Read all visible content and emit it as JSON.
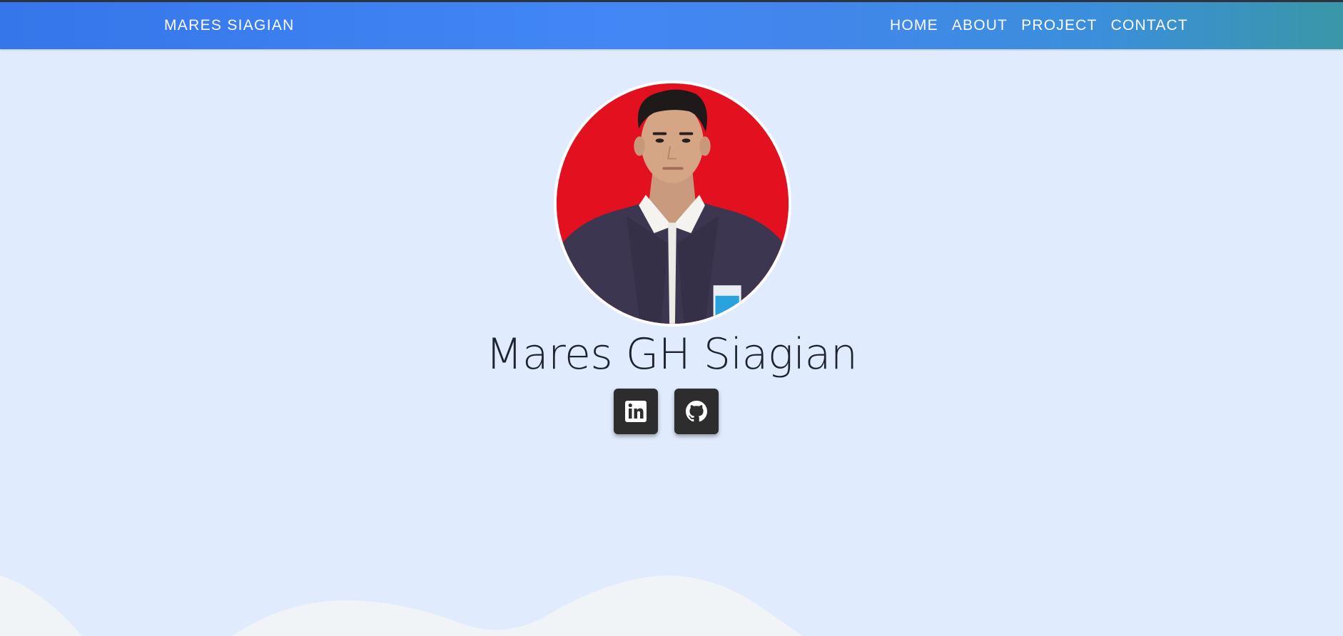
{
  "navbar": {
    "brand": "MARES SIAGIAN",
    "links": [
      {
        "label": "HOME"
      },
      {
        "label": "ABOUT"
      },
      {
        "label": "PROJECT"
      },
      {
        "label": "CONTACT"
      }
    ]
  },
  "hero": {
    "name": "Mares GH Siagian",
    "photo_alt": "Mares GH Siagian profile photo",
    "social": [
      {
        "icon": "linkedin-icon",
        "aria": "LinkedIn"
      },
      {
        "icon": "github-icon",
        "aria": "GitHub"
      }
    ]
  },
  "colors": {
    "page_background": "#e0ecfd",
    "nav_gradient_start": "#3576ea",
    "nav_gradient_end": "#3a97a7",
    "button_background": "#2d2d2d",
    "wave": "#f1f4f7"
  }
}
